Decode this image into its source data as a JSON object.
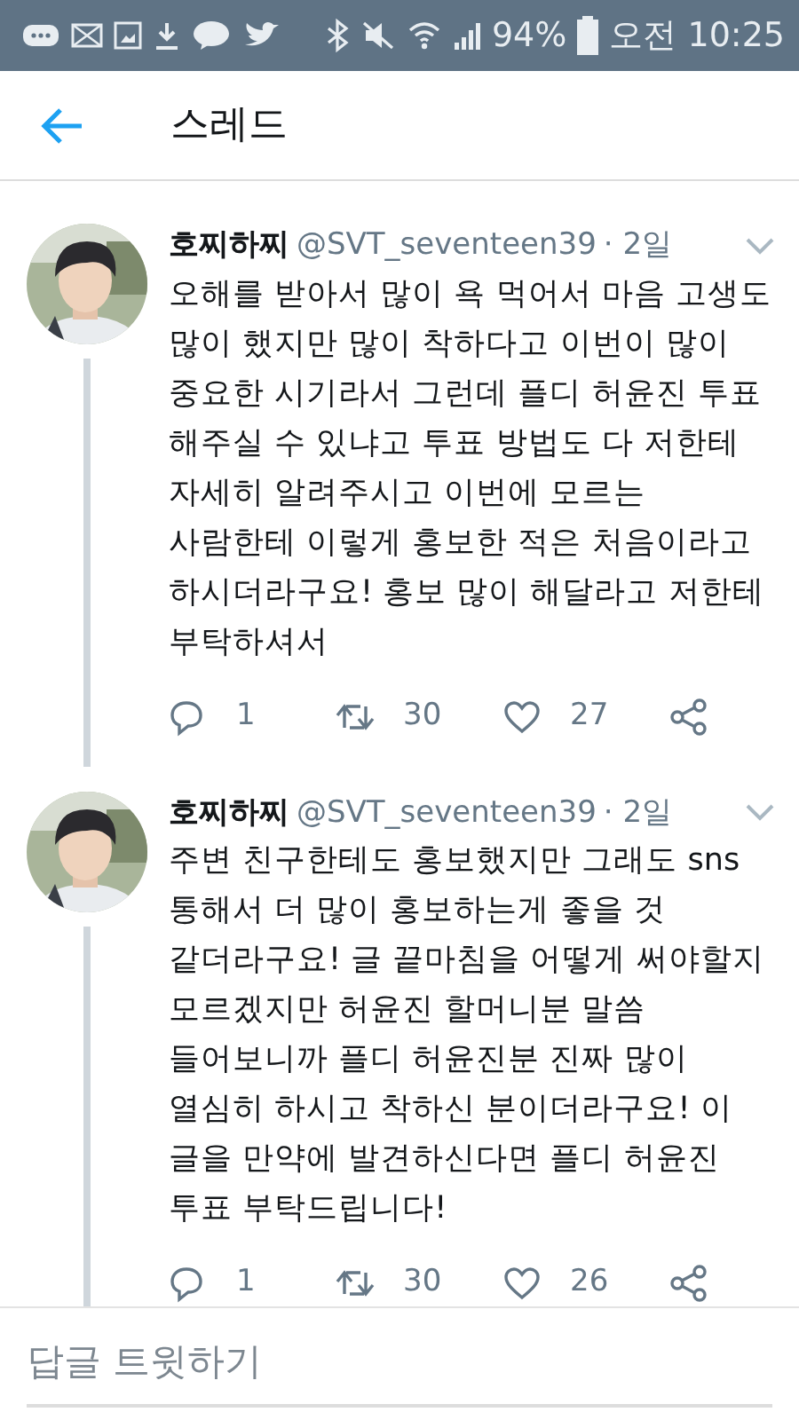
{
  "status_bar": {
    "battery": "94%",
    "time": "오전 10:25"
  },
  "header": {
    "title": "스레드"
  },
  "tweets": [
    {
      "name": "호찌하찌",
      "handle": "@SVT_seventeen39",
      "time": "· 2일",
      "text": "오해를 받아서 많이 욕 먹어서 마음 고생도\n많이 했지만 많이 착하다고 이번이 많이\n중요한 시기라서 그런데 플디 허윤진 투표\n해주실 수 있냐고 투표 방법도 다 저한테\n자세히 알려주시고 이번에 모르는\n사람한테 이렇게 홍보한 적은 처음이라고\n하시더라구요! 홍보 많이 해달라고 저한테\n부탁하셔서",
      "replies": "1",
      "retweets": "30",
      "likes": "27"
    },
    {
      "name": "호찌하찌",
      "handle": "@SVT_seventeen39",
      "time": "· 2일",
      "text": "주변 친구한테도 홍보했지만 그래도 sns\n통해서 더 많이 홍보하는게 좋을 것\n같더라구요! 글 끝마침을 어떻게 써야할지\n모르겠지만 허윤진 할머니분 말씀\n들어보니까 플디 허윤진분 진짜 많이\n열심히 하시고 착하신 분이더라구요! 이\n글을 만약에 발견하신다면 플디 허윤진\n투표 부탁드립니다!",
      "replies": "1",
      "retweets": "30",
      "likes": "26"
    }
  ],
  "reply_bar": {
    "placeholder": "답글 트윗하기"
  }
}
